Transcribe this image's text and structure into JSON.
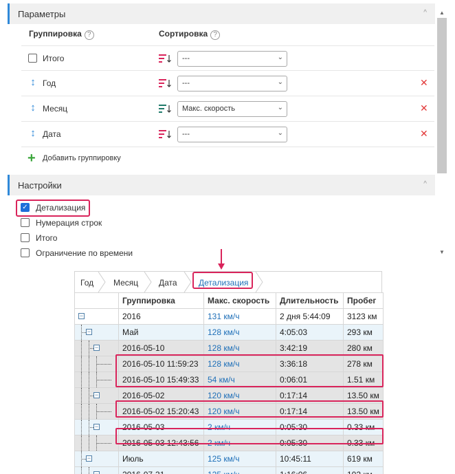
{
  "params": {
    "title": "Параметры",
    "col_grouping": "Группировка",
    "col_sorting": "Сортировка",
    "help": "?",
    "rows": [
      {
        "label": "Итого",
        "sort": "---"
      },
      {
        "label": "Год",
        "sort": "---"
      },
      {
        "label": "Месяц",
        "sort": "Макс. скорость"
      },
      {
        "label": "Дата",
        "sort": "---"
      }
    ],
    "add_grouping": "Добавить группировку"
  },
  "settings": {
    "title": "Настройки",
    "items": [
      {
        "label": "Детализация",
        "checked": true
      },
      {
        "label": "Нумерация строк",
        "checked": false
      },
      {
        "label": "Итого",
        "checked": false
      },
      {
        "label": "Ограничение по времени",
        "checked": false
      }
    ]
  },
  "breadcrumb": [
    "Год",
    "Месяц",
    "Дата",
    "Детализация"
  ],
  "table": {
    "headers": [
      "",
      "Группировка",
      "Макс. скорость",
      "Длительность",
      "Пробег"
    ],
    "rows": [
      {
        "level": 0,
        "name": "2016",
        "speed": "131 км/ч",
        "duration": "2 дня 5:44:09",
        "mileage": "3123 км"
      },
      {
        "level": 1,
        "name": "Май",
        "speed": "128 км/ч",
        "duration": "4:05:03",
        "mileage": "293 км"
      },
      {
        "level": 2,
        "name": "2016-05-10",
        "speed": "128 км/ч",
        "duration": "3:42:19",
        "mileage": "280 км"
      },
      {
        "level": 3,
        "name": "2016-05-10 11:59:23",
        "speed": "128 км/ч",
        "duration": "3:36:18",
        "mileage": "278 км"
      },
      {
        "level": 3,
        "name": "2016-05-10 15:49:33",
        "speed": "54 км/ч",
        "duration": "0:06:01",
        "mileage": "1.51 км"
      },
      {
        "level": 2,
        "name": "2016-05-02",
        "speed": "120 км/ч",
        "duration": "0:17:14",
        "mileage": "13.50 км"
      },
      {
        "level": 3,
        "name": "2016-05-02 15:20:43",
        "speed": "120 км/ч",
        "duration": "0:17:14",
        "mileage": "13.50 км"
      },
      {
        "level": 2,
        "name": "2016-05-03",
        "speed": "2 км/ч",
        "duration": "0:05:30",
        "mileage": "0.33 км"
      },
      {
        "level": 3,
        "name": "2016-05-03 12:43:56",
        "speed": "2 км/ч",
        "duration": "0:05:30",
        "mileage": "0.33 км"
      },
      {
        "level": 1,
        "name": "Июль",
        "speed": "125 км/ч",
        "duration": "10:45:11",
        "mileage": "619 км"
      },
      {
        "level": 2,
        "name": "2016-07-31",
        "speed": "125 км/ч",
        "duration": "1:16:06",
        "mileage": "102 км"
      }
    ]
  },
  "colors": {
    "accent": "#2f89d9",
    "highlight": "#d9245b",
    "link": "#1e6fb8",
    "delete": "#e23a3a",
    "add": "#3aa53a"
  },
  "icons": {
    "collapse": "⊟",
    "check": "✓",
    "delete": "✕",
    "add": "+",
    "move": "↕",
    "dropdown": "⌄",
    "collapse_section": "^",
    "scroll_up": "▲",
    "scroll_down": "▼"
  }
}
